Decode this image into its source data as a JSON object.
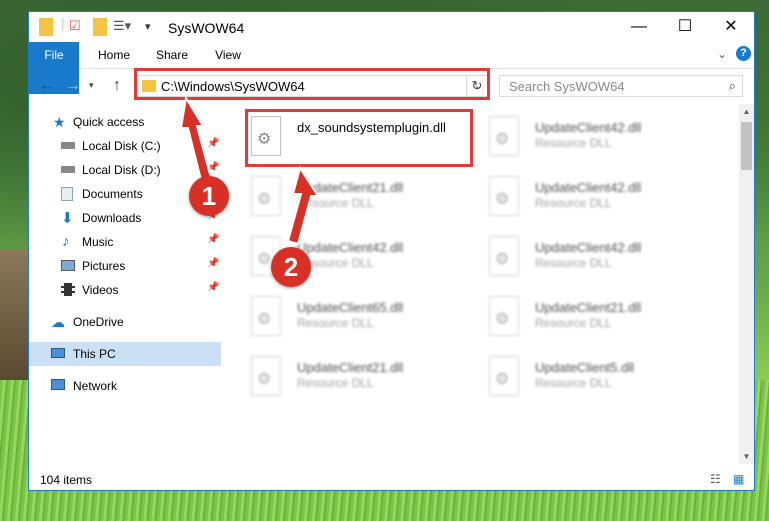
{
  "window": {
    "title": "SysWOW64"
  },
  "ribbon": {
    "tabs": [
      "File",
      "Home",
      "Share",
      "View"
    ]
  },
  "address": {
    "path": "C:\\Windows\\SysWOW64"
  },
  "search": {
    "placeholder": "Search SysWOW64"
  },
  "nav": {
    "quick_access": "Quick access",
    "items": [
      {
        "label": "Local Disk (C:)",
        "icon": "drive-icon",
        "pinned": true
      },
      {
        "label": "Local Disk (D:)",
        "icon": "drive-icon",
        "pinned": true
      },
      {
        "label": "Documents",
        "icon": "documents-icon",
        "pinned": true
      },
      {
        "label": "Downloads",
        "icon": "downloads-icon",
        "pinned": true
      },
      {
        "label": "Music",
        "icon": "music-icon",
        "pinned": true
      },
      {
        "label": "Pictures",
        "icon": "pictures-icon",
        "pinned": true
      },
      {
        "label": "Videos",
        "icon": "videos-icon",
        "pinned": true
      }
    ],
    "onedrive": "OneDrive",
    "this_pc": "This PC",
    "network": "Network"
  },
  "files": [
    {
      "name": "dx_soundsystemplugin.dll",
      "type": ""
    },
    {
      "name": "UpdateClient42.dll",
      "type": "Resource DLL"
    },
    {
      "name": "UpdateClient21.dll",
      "type": "Resource DLL"
    },
    {
      "name": "UpdateClient42.dll",
      "type": "Resource DLL"
    },
    {
      "name": "UpdateClient42.dll",
      "type": "Resource DLL"
    },
    {
      "name": "UpdateClient42.dll",
      "type": "Resource DLL"
    },
    {
      "name": "UpdateClient65.dll",
      "type": "Resource DLL"
    },
    {
      "name": "UpdateClient21.dll",
      "type": "Resource DLL"
    },
    {
      "name": "UpdateClient21.dll",
      "type": "Resource DLL"
    },
    {
      "name": "UpdateClient5.dll",
      "type": "Resource DLL"
    }
  ],
  "status": {
    "item_count": "104 items"
  },
  "annotations": {
    "step1": "1",
    "step2": "2"
  },
  "colors": {
    "accent": "#1979ca",
    "highlight": "#e53935",
    "badge": "#d93025"
  }
}
